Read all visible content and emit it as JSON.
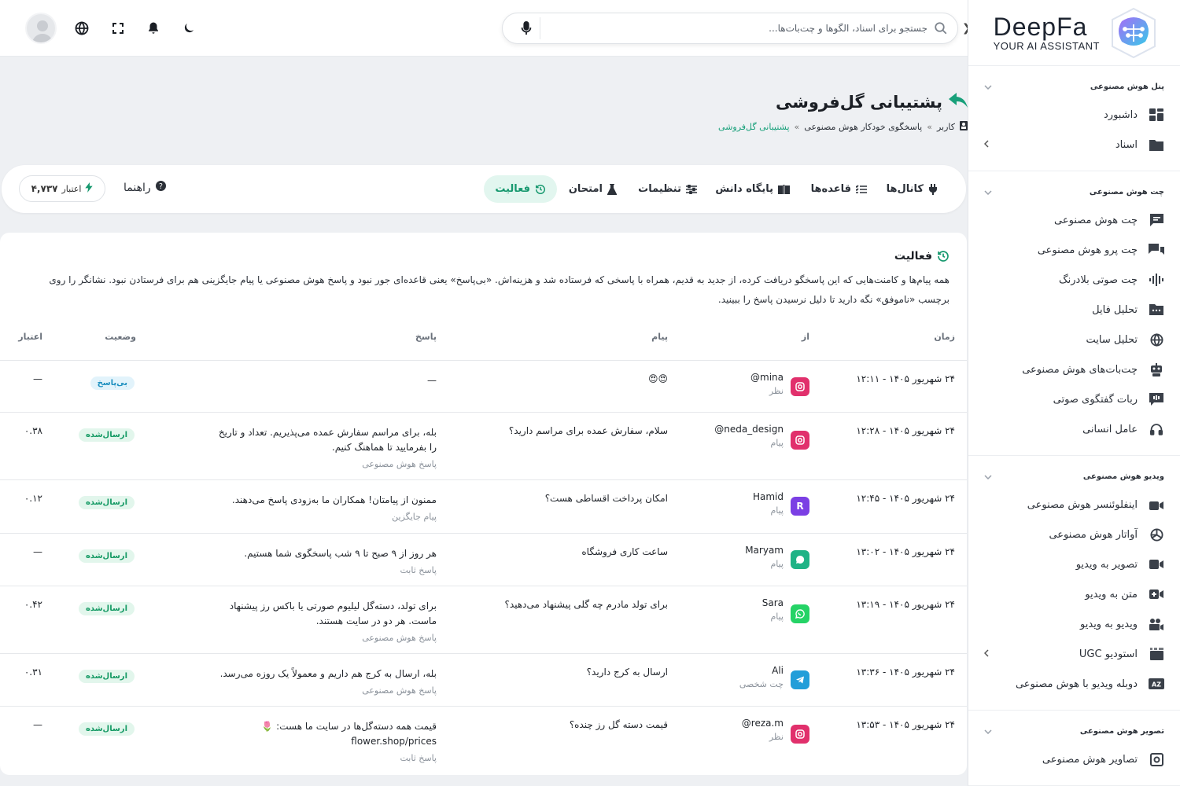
{
  "brand": {
    "name": "DeepFa",
    "tagline": "YOUR AI ASSISTANT"
  },
  "topbar": {
    "search_placeholder": "جستجو برای اسناد، الگوها و چت‌بات‌ها..."
  },
  "sidebar": {
    "sections": [
      {
        "title": "پنل هوش مصنوعی",
        "items": [
          {
            "label": "داشبورد",
            "icon": "dashboard-icon"
          },
          {
            "label": "اسناد",
            "icon": "folder-icon",
            "has_sub": true
          }
        ]
      },
      {
        "title": "چت هوش مصنوعی",
        "items": [
          {
            "label": "چت هوش مصنوعی",
            "icon": "chat-icon"
          },
          {
            "label": "چت پرو هوش مصنوعی",
            "icon": "chat-pro-icon"
          },
          {
            "label": "چت صوتی بلادرنگ",
            "icon": "voice-wave-icon"
          },
          {
            "label": "تحلیل فایل",
            "icon": "file-analyze-icon"
          },
          {
            "label": "تحلیل سایت",
            "icon": "globe-icon"
          },
          {
            "label": "چت‌بات‌های هوش مصنوعی",
            "icon": "robot-icon"
          },
          {
            "label": "ربات گفتگوی صوتی",
            "icon": "voice-bot-icon"
          },
          {
            "label": "عامل انسانی",
            "icon": "headset-icon"
          }
        ]
      },
      {
        "title": "ویدیو هوش مصنوعی",
        "items": [
          {
            "label": "اینفلوئنسر هوش مصنوعی",
            "icon": "influencer-icon"
          },
          {
            "label": "آواتار هوش مصنوعی",
            "icon": "avatar-icon"
          },
          {
            "label": "تصویر به ویدیو",
            "icon": "video-camera-icon"
          },
          {
            "label": "متن به ویدیو",
            "icon": "text-video-icon"
          },
          {
            "label": "ویدیو به ویدیو",
            "icon": "video-video-icon"
          },
          {
            "label": "استودیو UGC",
            "icon": "studio-icon",
            "has_sub": true
          },
          {
            "label": "دوبله ویدیو با هوش مصنوعی",
            "icon": "dubbing-icon"
          }
        ]
      },
      {
        "title": "تصویر هوش مصنوعی",
        "items": [
          {
            "label": "تصاویر هوش مصنوعی",
            "icon": "image-icon"
          }
        ]
      }
    ]
  },
  "page": {
    "title": "پشتیبانی گل‌فروشی",
    "breadcrumb": [
      "کاربر",
      "پاسخگوی خودکار هوش مصنوعی",
      "پشتیبانی گل‌فروشی"
    ]
  },
  "tabs": [
    {
      "label": "کانال‌ها",
      "icon": "channels-icon",
      "active": false
    },
    {
      "label": "قاعده‌ها",
      "icon": "rules-icon",
      "active": false
    },
    {
      "label": "پایگاه دانش",
      "icon": "book-icon",
      "active": false
    },
    {
      "label": "تنظیمات",
      "icon": "sliders-icon",
      "active": false
    },
    {
      "label": "امتحان",
      "icon": "flask-icon",
      "active": false
    },
    {
      "label": "فعالیت",
      "icon": "history-icon",
      "active": true
    }
  ],
  "help_label": "راهنما",
  "credit": {
    "label": "اعتبار",
    "value": "۴,۷۳۷"
  },
  "activity": {
    "title": "فعالیت",
    "description": "همه پیام‌ها و کامنت‌هایی که این پاسخگو دریافت کرده، از جدید به قدیم، همراه با پاسخی که فرستاده شد و هزینه‌اش. «بی‌پاسخ» یعنی قاعده‌ای جور نبود و پاسخ هوش مصنوعی یا پیام جایگزینی هم برای فرستادن نبود. نشانگر را روی برچسب «ناموفق» نگه دارید تا دلیل نرسیدن پاسخ را ببینید.",
    "columns": {
      "time": "زمان",
      "from": "از",
      "message": "پیام",
      "reply": "پاسخ",
      "status": "وضعیت",
      "credit": "اعتبار"
    },
    "rows": [
      {
        "time": "۲۴ شهریور ۱۴۰۵ - ۱۲:۱۱",
        "from": "@mina",
        "type": "نظر",
        "channel": "instagram",
        "message": "😍😍",
        "reply": "—",
        "reply_source": "",
        "status": "بی‌پاسخ",
        "status_kind": "none",
        "credit": "—"
      },
      {
        "time": "۲۴ شهریور ۱۴۰۵ - ۱۲:۲۸",
        "from": "@neda_design",
        "type": "پیام",
        "channel": "instagram",
        "message": "سلام، سفارش عمده برای مراسم دارید؟",
        "reply": "بله، برای مراسم سفارش عمده می‌پذیریم. تعداد و تاریخ را بفرمایید تا هماهنگ کنیم.",
        "reply_source": "پاسخ هوش مصنوعی",
        "status": "ارسال‌شده",
        "status_kind": "sent",
        "credit": "۰.۳۸"
      },
      {
        "time": "۲۴ شهریور ۱۴۰۵ - ۱۲:۴۵",
        "from": "Hamid",
        "type": "پیام",
        "channel": "rubika",
        "message": "امکان پرداخت اقساطی هست؟",
        "reply": "ممنون از پیامتان! همکاران ما به‌زودی پاسخ می‌دهند.",
        "reply_source": "پیام جایگزین",
        "status": "ارسال‌شده",
        "status_kind": "sent",
        "credit": "۰.۱۲"
      },
      {
        "time": "۲۴ شهریور ۱۴۰۵ - ۱۳:۰۲",
        "from": "Maryam",
        "type": "پیام",
        "channel": "webchat",
        "message": "ساعت کاری فروشگاه",
        "reply": "هر روز از ۹ صبح تا ۹ شب پاسخگوی شما هستیم.",
        "reply_source": "پاسخ ثابت",
        "status": "ارسال‌شده",
        "status_kind": "sent",
        "credit": "—"
      },
      {
        "time": "۲۴ شهریور ۱۴۰۵ - ۱۳:۱۹",
        "from": "Sara",
        "type": "پیام",
        "channel": "whatsapp",
        "message": "برای تولد مادرم چه گلی پیشنهاد می‌دهید؟",
        "reply": "برای تولد، دسته‌گل لیلیوم صورتی یا باکس رز پیشنهاد ماست. هر دو در سایت هستند.",
        "reply_source": "پاسخ هوش مصنوعی",
        "status": "ارسال‌شده",
        "status_kind": "sent",
        "credit": "۰.۴۲"
      },
      {
        "time": "۲۴ شهریور ۱۴۰۵ - ۱۳:۳۶",
        "from": "Ali",
        "type": "چت شخصی",
        "channel": "telegram",
        "message": "ارسال به کرج دارید؟",
        "reply": "بله، ارسال به کرج هم داریم و معمولاً یک روزه می‌رسد.",
        "reply_source": "پاسخ هوش مصنوعی",
        "status": "ارسال‌شده",
        "status_kind": "sent",
        "credit": "۰.۳۱"
      },
      {
        "time": "۲۴ شهریور ۱۴۰۵ - ۱۳:۵۳",
        "from": "@reza.m",
        "type": "نظر",
        "channel": "instagram",
        "message": "قیمت دسته گل رز چنده؟",
        "reply": "قیمت همه دسته‌گل‌ها در سایت ما هست: 🌷 flower.shop/prices",
        "reply_source": "پاسخ ثابت",
        "status": "ارسال‌شده",
        "status_kind": "sent",
        "credit": "—"
      }
    ]
  },
  "colors": {
    "accent": "#17996f",
    "instagram": "#e1306c",
    "rubika": "#7b3fe4",
    "webchat": "#1fb386",
    "whatsapp": "#25d366",
    "telegram": "#229ed9"
  }
}
